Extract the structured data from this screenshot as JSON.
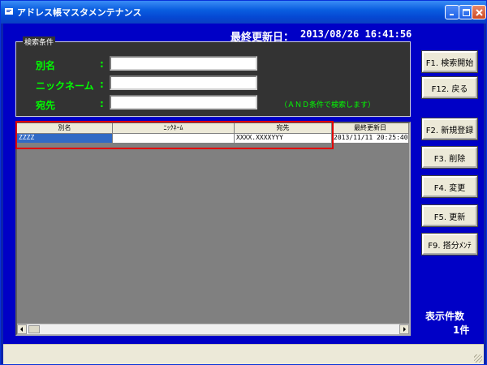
{
  "window": {
    "title": "アドレス帳マスタメンテナンス"
  },
  "header": {
    "last_updated_label": "最終更新日：",
    "last_updated_value": "2013/08/26 16:41:56"
  },
  "search": {
    "legend": "検索条件",
    "alias_label": "別名",
    "nickname_label": "ニックネーム",
    "dest_label": "宛先",
    "colon": ":",
    "alias_value": "",
    "nickname_value": "",
    "dest_value": "",
    "hint": "（ＡＮＤ条件で検索します）"
  },
  "grid": {
    "columns": [
      "別名",
      "ﾆｯｸﾈｰﾑ",
      "宛先",
      "最終更新日"
    ],
    "rows": [
      [
        "ZZZZ",
        "",
        "XXXX.XXXXYYY",
        "2013/11/11 20:25:40"
      ]
    ]
  },
  "buttons": {
    "search": "F1. 検索開始",
    "back": "F12. 戻る",
    "new": "F2. 新規登録",
    "delete": "F3. 削除",
    "change": "F4. 変更",
    "update": "F5. 更新",
    "bulk": "F9. 搭分ﾒﾝﾃ"
  },
  "summary": {
    "count_label": "表示件数",
    "count_value": "1件"
  },
  "colors": {
    "background": "#0000c6",
    "label_green": "#00ff00",
    "panel": "#333333",
    "highlight": "#e00000"
  }
}
